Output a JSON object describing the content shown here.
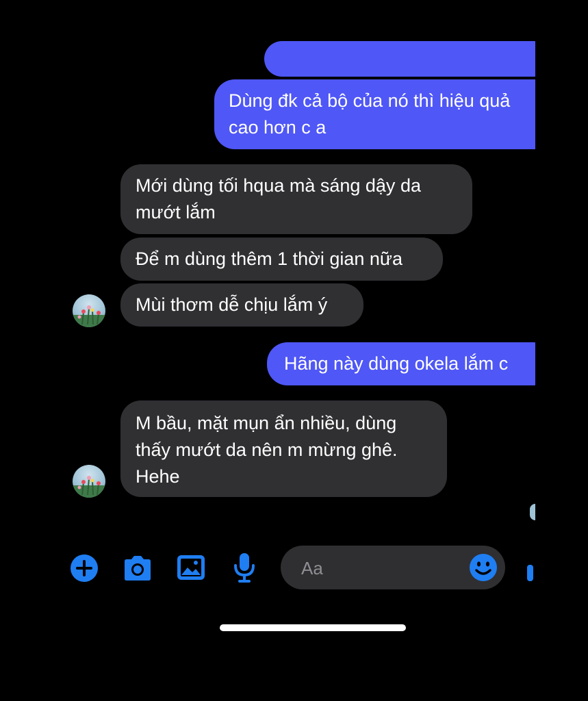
{
  "conversation": {
    "messages": [
      {
        "id": "m0",
        "direction": "outgoing",
        "text": ""
      },
      {
        "id": "m1",
        "direction": "outgoing",
        "text": "Dùng đk cả bộ của nó thì hiệu quả\ncao hơn c a"
      },
      {
        "id": "m2",
        "direction": "incoming",
        "text": "Mới dùng tối hqua mà sáng dậy da\nmướt lắm"
      },
      {
        "id": "m3",
        "direction": "incoming",
        "text": "Để m dùng thêm 1 thời gian nữa"
      },
      {
        "id": "m4",
        "direction": "incoming",
        "text": "Mùi thơm dễ chịu lắm ý"
      },
      {
        "id": "m5",
        "direction": "outgoing",
        "text": "Hãng này dùng okela lắm c"
      },
      {
        "id": "m6",
        "direction": "incoming",
        "text": "M bầu, mặt mụn ẩn nhiều, dùng\nthấy mướt da nên m mừng ghê.\nHehe"
      }
    ]
  },
  "composer": {
    "placeholder": "Aa",
    "value": "",
    "icons": [
      "plus-icon",
      "camera-icon",
      "photo-icon",
      "microphone-icon",
      "emoji-icon"
    ]
  },
  "colors": {
    "outgoing_bubble": "#4f57f6",
    "incoming_bubble": "#303033",
    "accent": "#1f7ef2",
    "background": "#000000"
  }
}
